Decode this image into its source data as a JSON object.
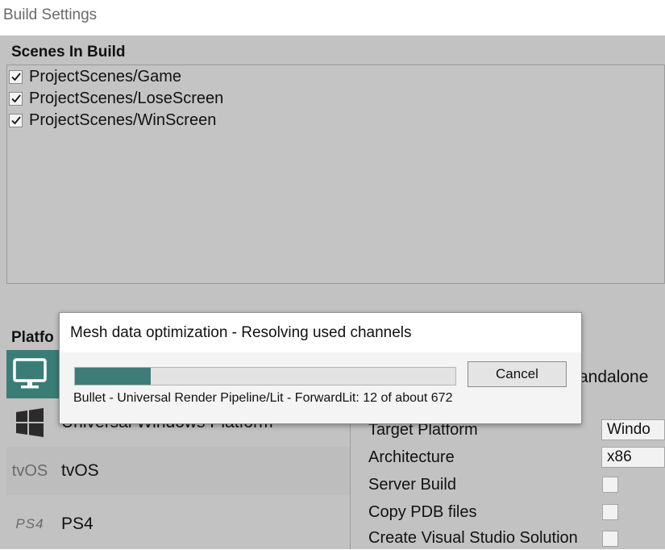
{
  "window": {
    "title": "Build Settings"
  },
  "scenes": {
    "header": "Scenes In Build",
    "items": [
      {
        "name": "ProjectScenes/Game",
        "checked": true
      },
      {
        "name": "ProjectScenes/LoseScreen",
        "checked": true
      },
      {
        "name": "ProjectScenes/WinScreen",
        "checked": true
      }
    ]
  },
  "platform": {
    "header": "Platfo",
    "items": [
      {
        "label": "",
        "icon": "monitor-icon",
        "selected": true
      },
      {
        "label": "Universal Windows Platform",
        "icon": "windows-logo-icon",
        "selected": false
      },
      {
        "label": "tvOS",
        "icon_text": "tvOS",
        "icon": "tvos-logo-icon",
        "selected": false
      },
      {
        "label": "PS4",
        "icon_text": "PS4",
        "icon": "ps4-logo-icon",
        "selected": false
      }
    ],
    "selected_heading": "andalone"
  },
  "settings": {
    "target_platform_label": "Target Platform",
    "target_platform_value": "Windo",
    "architecture_label": "Architecture",
    "architecture_value": "x86",
    "server_build_label": "Server Build",
    "copy_pdb_label": "Copy PDB files",
    "create_vs_label": "Create Visual Studio Solution"
  },
  "progress_dialog": {
    "title": "Mesh data optimization - Resolving used channels",
    "progress": 0.2,
    "cancel_label": "Cancel",
    "status": "Bullet - Universal Render Pipeline/Lit - ForwardLit:  12 of about 672"
  },
  "colors": {
    "accent": "#3a7d76",
    "panel": "#c2c2c2"
  }
}
